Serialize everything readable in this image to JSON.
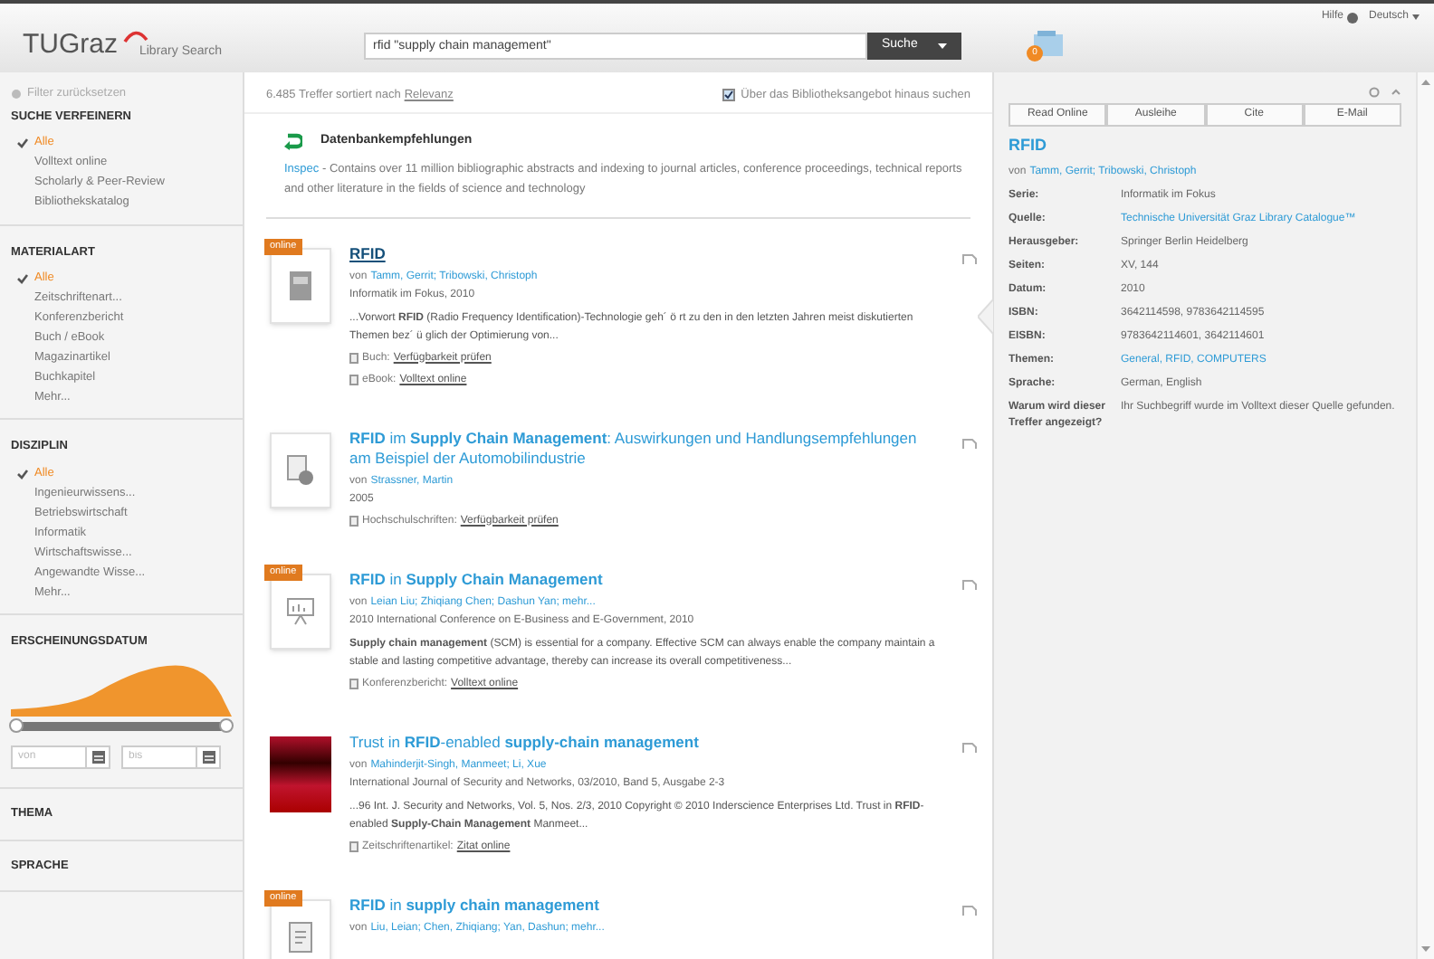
{
  "header": {
    "logo": "TUGraz",
    "logo_sub": "Library Search",
    "search_value": "rfid \"supply chain management\"",
    "search_button": "Suche",
    "cart_count": "0",
    "help": "Hilfe",
    "language": "Deutsch"
  },
  "sidebar": {
    "reset": "Filter zurücksetzen",
    "sections": [
      {
        "title": "SUCHE VERFEINERN",
        "items": [
          {
            "label": "Alle",
            "selected": true
          },
          {
            "label": "Volltext online",
            "selected": false
          },
          {
            "label": "Scholarly & Peer-Review",
            "selected": false
          },
          {
            "label": "Bibliothekskatalog",
            "selected": false
          }
        ]
      },
      {
        "title": "MATERIALART",
        "items": [
          {
            "label": "Alle",
            "selected": true
          },
          {
            "label": "Zeitschriftenart...",
            "selected": false
          },
          {
            "label": "Konferenzbericht",
            "selected": false
          },
          {
            "label": "Buch / eBook",
            "selected": false
          },
          {
            "label": "Magazinartikel",
            "selected": false
          },
          {
            "label": "Buchkapitel",
            "selected": false
          },
          {
            "label": "Mehr...",
            "selected": false
          }
        ]
      },
      {
        "title": "DISZIPLIN",
        "items": [
          {
            "label": "Alle",
            "selected": true
          },
          {
            "label": "Ingenieurwissens...",
            "selected": false
          },
          {
            "label": "Betriebswirtschaft",
            "selected": false
          },
          {
            "label": "Informatik",
            "selected": false
          },
          {
            "label": "Wirtschaftswisse...",
            "selected": false
          },
          {
            "label": "Angewandte Wisse...",
            "selected": false
          },
          {
            "label": "Mehr...",
            "selected": false
          }
        ]
      }
    ],
    "date": {
      "title": "ERSCHEINUNGSDATUM",
      "level": 1,
      "fields": [
        {
          "placeholder": "von"
        },
        {
          "placeholder": "bis"
        }
      ]
    },
    "collapsed": [
      "THEMA",
      "SPRACHE"
    ]
  },
  "results_bar": {
    "count": "6.485 Treffer sortiert nach",
    "sort": "Relevanz",
    "beyond": {
      "label": "Über das Bibliotheksangebot hinaus suchen",
      "checked": true
    }
  },
  "recommendation": {
    "title": "Datenbankempfehlungen",
    "database": "Inspec",
    "text": "- Contains over 11 million bibliographic abstracts and indexing to journal articles, conference proceedings, technical reports and other literature in the fields of science and technology"
  },
  "results": [
    {
      "selected": true,
      "badge": "online",
      "kind": "book",
      "title": "**RFID**",
      "by": "von",
      "authors": "Tamm, Gerrit; Tribowski, Christoph",
      "source": "Informatik im Fokus, 2010",
      "snippet": "...Vorwort **RFID** (Radio Frequency Identification)-Technologie geh´ ö rt zu den in den letzten Jahren meist diskutierten Themen bez´ ü glich der Optimierung von...",
      "links": [
        {
          "label": "Buch:",
          "link": "Verfügbarkeit prüfen"
        },
        {
          "label": "eBook:",
          "link": "Volltext online"
        }
      ]
    },
    {
      "selected": false,
      "kind": "thesis",
      "title": "**RFID** im **Supply Chain Management**: Auswirkungen und Handlungsempfehlungen am Beispiel der Automobilindustrie",
      "by": "von",
      "authors": "Strassner, Martin",
      "source": "2005",
      "links": [
        {
          "label": "Hochschulschriften:",
          "link": "Verfügbarkeit prüfen"
        }
      ]
    },
    {
      "selected": false,
      "badge": "online",
      "kind": "presentation",
      "title": "**RFID** in **Supply Chain Management**",
      "by": "von",
      "authors": "Leian Liu; Zhiqiang Chen; Dashun Yan; mehr...",
      "source": "2010 International Conference on E-Business and E-Government, 2010",
      "snippet": "**Supply chain management** (SCM) is essential for a company. Effective SCM can always enable the company maintain a stable and lasting competitive advantage, thereby can increase its overall competitiveness...",
      "links": [
        {
          "label": "Konferenzbericht:",
          "link": "Volltext online"
        }
      ]
    },
    {
      "selected": false,
      "kind": "cover",
      "title": "Trust in **RFID**-enabled **supply-chain management**",
      "by": "von",
      "authors": "Mahinderjit-Singh, Manmeet; Li, Xue",
      "source": "International Journal of Security and Networks, 03/2010, Band 5, Ausgabe 2-3",
      "snippet": "...96 Int. J. Security and Networks, Vol. 5, Nos. 2/3, 2010 Copyright © 2010 Inderscience Enterprises Ltd. Trust in **RFID**-enabled **Supply-Chain Management** Manmeet...",
      "links": [
        {
          "label": "Zeitschriftenartikel:",
          "link": "Zitat online"
        }
      ]
    },
    {
      "selected": false,
      "badge": "online",
      "kind": "document",
      "title": "**RFID** in **supply chain management**",
      "by": "von",
      "authors": "Liu, Leian; Chen, Zhiqiang; Yan, Dashun; mehr..."
    }
  ],
  "detail": {
    "buttons": [
      "Read Online",
      "Ausleihe",
      "Cite",
      "E-Mail"
    ],
    "title": "RFID",
    "by": "von",
    "authors": "Tamm, Gerrit; Tribowski, Christoph",
    "fields": [
      {
        "label": "Serie:",
        "value": "Informatik im Fokus",
        "kind": "text"
      },
      {
        "label": "Quelle:",
        "value": "Technische Universität Graz Library Catalogue™",
        "kind": "link"
      },
      {
        "label": "Herausgeber:",
        "value": "Springer Berlin Heidelberg",
        "kind": "text"
      },
      {
        "label": "Seiten:",
        "value": "XV, 144",
        "kind": "text"
      },
      {
        "label": "Datum:",
        "value": "2010",
        "kind": "text"
      },
      {
        "label": "ISBN:",
        "value": "3642114598, 9783642114595",
        "kind": "text"
      },
      {
        "label": "EISBN:",
        "value": "9783642114601, 3642114601",
        "kind": "text"
      },
      {
        "label": "Themen:",
        "value": "General, RFID, COMPUTERS",
        "kind": "link"
      },
      {
        "label": "Sprache:",
        "value": "German, English",
        "kind": "text"
      },
      {
        "label": "Warum wird dieser Treffer angezeigt?",
        "value": "Ihr Suchbegriff wurde im Volltext dieser Quelle gefunden.",
        "kind": "text"
      }
    ]
  }
}
